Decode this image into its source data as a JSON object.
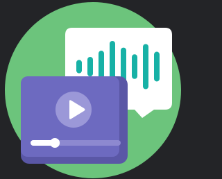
{
  "illustration": {
    "icon": "video-audio-icon",
    "colors": {
      "background": "#232427",
      "circle": "#6CC47C",
      "bubble": "#FFFFFF",
      "bars": "#17B1A6",
      "player_dark": "#5A57A6",
      "player_screen": "#6D6AC0",
      "play_circle": "#9B98D8",
      "play_triangle": "#FFFFFF",
      "progress_track": "#8D89D0",
      "progress_fill": "#FFFFFF"
    },
    "audio_levels": [
      0.26,
      0.38,
      0.62,
      1.0,
      0.74,
      0.48,
      0.88,
      0.58
    ],
    "video_progress": 0.27
  }
}
